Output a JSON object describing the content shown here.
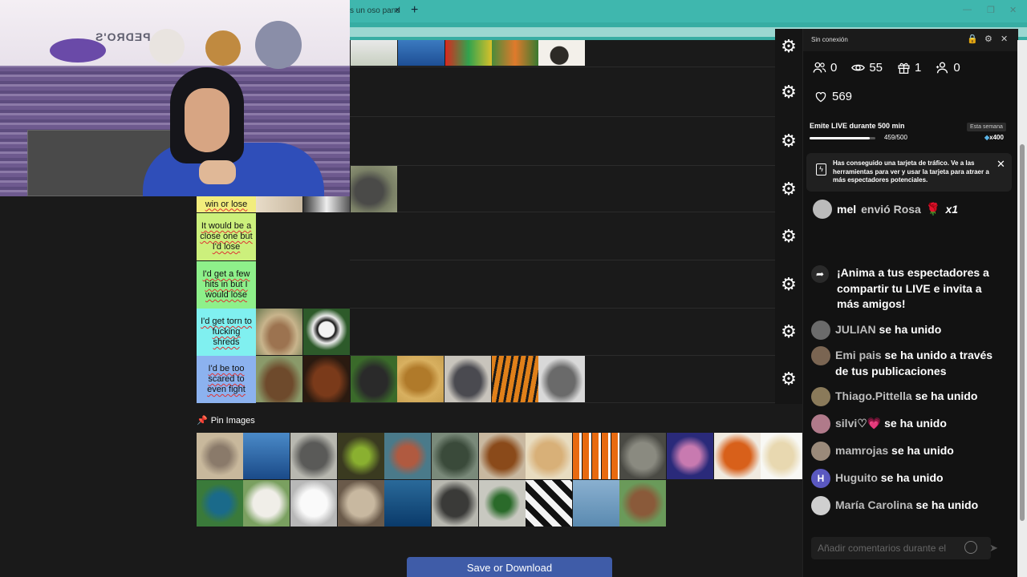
{
  "browser": {
    "tab_title": "s un oso pand",
    "tab_close": "×",
    "new_tab": "+",
    "minimize": "—",
    "restore": "❐",
    "close": "✕"
  },
  "webcam": {
    "sign_text": "PEDRO'S"
  },
  "tiers": [
    {
      "label": "win or lose",
      "color": "#f2ed7c",
      "images": [
        "dog-image",
        "eagle-image",
        "komodo-dragon-image"
      ]
    },
    {
      "label": "It would be a close one but I'd lose",
      "color": "#ccf07c",
      "images": []
    },
    {
      "label": "I'd get a few hits in but I would lose",
      "color": "#8ef08a",
      "images": []
    },
    {
      "label": "I'd get torn to fucking shreds",
      "color": "#80f0f0",
      "images": [
        "deer-image",
        "panda-image"
      ]
    },
    {
      "label": "I'd be too scared to even fight",
      "color": "#8cb2ef",
      "images": [
        "bear-image",
        "orangutan-image",
        "gorilla-image",
        "lion-image",
        "hippo-image",
        "tiger-image",
        "rhino-image"
      ]
    }
  ],
  "top_images": [
    "snake-image",
    "sea-image",
    "macaw-image",
    "bird-image",
    "monkey-image"
  ],
  "pin": {
    "title": "Pin Images",
    "row1": [
      "kangaroo",
      "shark",
      "elephant",
      "python",
      "starfish",
      "crocodile",
      "horse",
      "cheetah",
      "clownfish",
      "cat",
      "octopus",
      "crab",
      "golden-retriever"
    ],
    "row2": [
      "peacock",
      "sheep",
      "swan",
      "owl",
      "whale",
      "seal",
      "duck",
      "cow",
      "dolphin",
      "goat"
    ]
  },
  "save_button": "Save or Download",
  "live": {
    "offline": "Sin conexión",
    "stats": {
      "viewers_joined": "0",
      "views": "55",
      "gifts": "1",
      "followers": "0"
    },
    "likes": "569",
    "goal_label": "Emite LIVE durante 500 min",
    "goal_period": "Esta semana",
    "goal_progress_text": "459/500",
    "goal_progress_fraction": 0.918,
    "goal_reward": "x400",
    "notice_text": "Has conseguido una tarjeta de tráfico. Ve a las herramientas para ver y usar la tarjeta para atraer a más espectadores potenciales.",
    "gift": {
      "user": "mel",
      "action": "envió Rosa",
      "count": "x1"
    },
    "share_text": "¡Anima a tus espectadores a compartir tu LIVE e invita a más amigos!",
    "chat": [
      {
        "name": "JULIAN",
        "msg": "se ha unido",
        "avatar": "#6b6b6b"
      },
      {
        "name": "Emi pais",
        "msg": "se ha unido a través de tus publicaciones",
        "avatar": "#7a6552"
      },
      {
        "name": "Thiago.Pittella",
        "msg": "se ha unido",
        "avatar": "#8a7a5a"
      },
      {
        "name": "silvi♡💗",
        "msg": "se ha unido",
        "avatar": "#b07a8a"
      },
      {
        "name": "mamrojas",
        "msg": "se ha unido",
        "avatar": "#9a8a7a"
      },
      {
        "name": "Huguito",
        "msg": "se ha unido",
        "avatar": "#5a58c0",
        "initial": "H"
      },
      {
        "name": "María Carolina",
        "msg": "se ha unido",
        "avatar": "#cfcfcf"
      }
    ],
    "comment_placeholder": "Añadir comentarios durante el"
  }
}
